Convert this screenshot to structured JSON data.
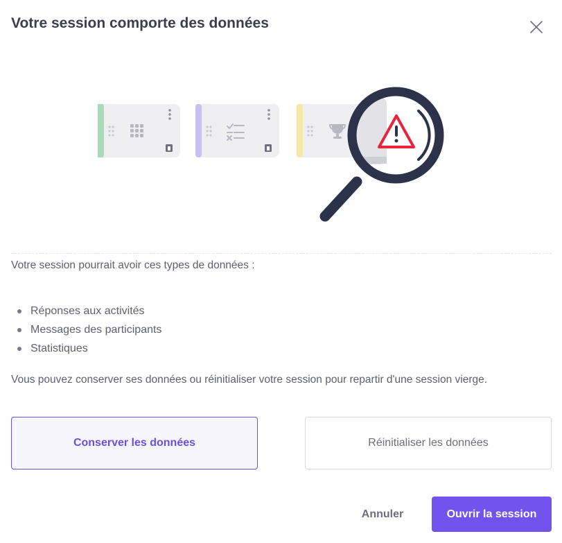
{
  "dialog": {
    "title": "Votre session comporte des données",
    "close_icon": "close-icon"
  },
  "illustration": {
    "cards": [
      {
        "icon": "grid-icon",
        "accent": "#a8dcb8"
      },
      {
        "icon": "checklist-icon",
        "accent": "#c9c0f2"
      },
      {
        "icon": "trophy-icon",
        "accent": "#f6e9a8"
      }
    ],
    "magnifier_icon": "magnifier-icon",
    "warning_icon": "warning-icon",
    "warning_color": "#e8253f",
    "magnifier_color": "#2b3249"
  },
  "content": {
    "intro": "Votre session pourrait avoir ces types de données :",
    "data_types": [
      "Réponses aux activités",
      "Messages des participants",
      "Statistiques"
    ],
    "note": "Vous pouvez conserver ses données ou réinitialiser votre session pour repartir d'une session vierge."
  },
  "choices": {
    "keep_label": "Conserver les données",
    "reset_label": "Réinitialiser les données",
    "selected": "keep"
  },
  "footer": {
    "cancel_label": "Annuler",
    "open_label": "Ouvrir la session"
  },
  "colors": {
    "primary": "#7253ed",
    "selected_border": "#6a4fe0",
    "selected_bg": "#f7f5fe"
  }
}
